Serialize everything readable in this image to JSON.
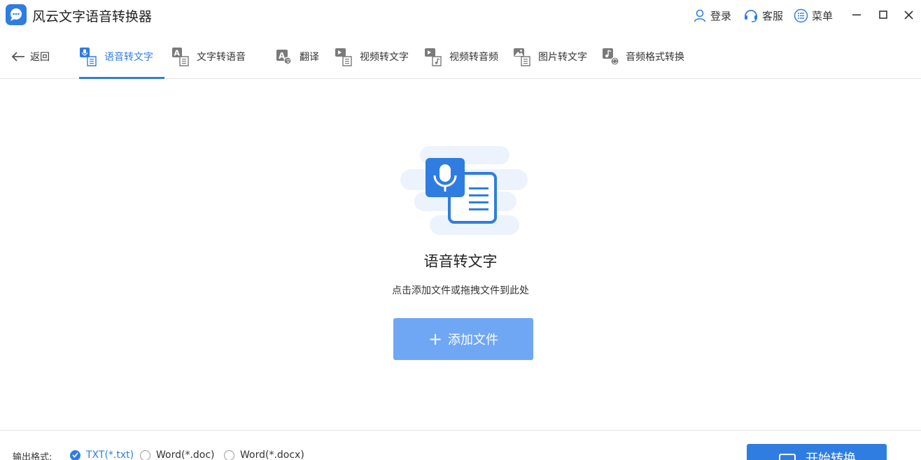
{
  "app": {
    "title": "风云文字语音转换器",
    "accent": "#2f7de1"
  },
  "titlebar": {
    "login": "登录",
    "service": "客服",
    "menu": "菜单"
  },
  "nav": {
    "back": "返回",
    "tabs": [
      {
        "label": "语音转文字",
        "icon": "mic-doc-icon",
        "active": true
      },
      {
        "label": "文字转语音",
        "icon": "text-speech-icon",
        "active": false
      },
      {
        "label": "翻译",
        "icon": "translate-icon",
        "active": false
      },
      {
        "label": "视频转文字",
        "icon": "video-doc-icon",
        "active": false
      },
      {
        "label": "视频转音频",
        "icon": "video-audio-icon",
        "active": false
      },
      {
        "label": "图片转文字",
        "icon": "image-doc-icon",
        "active": false
      },
      {
        "label": "音频格式转换",
        "icon": "audio-convert-icon",
        "active": false
      }
    ]
  },
  "main": {
    "title": "语音转文字",
    "hint": "点击添加文件或拖拽文件到此处",
    "add_button": "添加文件"
  },
  "bottom": {
    "format_label": "输出格式:",
    "formats": [
      {
        "label": "TXT(*.txt)",
        "checked": true
      },
      {
        "label": "Word(*.doc)",
        "checked": false
      },
      {
        "label": "Word(*.docx)",
        "checked": false
      }
    ],
    "start_button": "开始转换"
  }
}
